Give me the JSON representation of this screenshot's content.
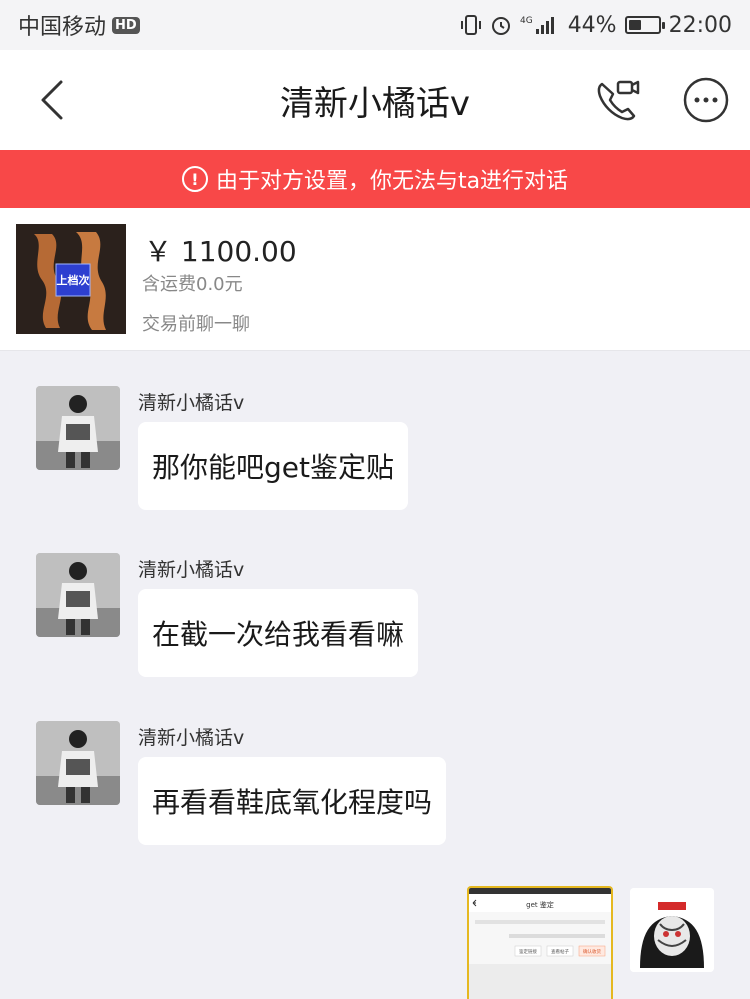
{
  "status_bar": {
    "carrier": "中国移动",
    "hd_badge": "HD",
    "network": "4G",
    "battery": "44%",
    "battery_level": 0.44,
    "time": "22:00"
  },
  "nav": {
    "title": "清新小橘话v",
    "back_icon": "chevron-left-icon",
    "call_icon": "video-phone-icon",
    "more_icon": "more-horizontal-icon"
  },
  "warning": {
    "icon": "!",
    "text": "由于对方设置，你无法与ta进行对话",
    "color": "#f84848"
  },
  "product": {
    "thumb_label": "上档次",
    "price": "￥ 1100.00",
    "shipping": "含运费0.0元",
    "prechat": "交易前聊一聊"
  },
  "messages": [
    {
      "sender": "清新小橘话v",
      "text": "那你能吧get鉴定贴"
    },
    {
      "sender": "清新小橘话v",
      "text": "在截一次给我看看嘛"
    },
    {
      "sender": "清新小橘话v",
      "text": "再看看鞋底氧化程度吗"
    }
  ],
  "outgoing": {
    "thumb_title": "get 鉴定",
    "thumb_buttons": [
      "鉴定链接",
      "查看帖子",
      "确认收货"
    ]
  }
}
